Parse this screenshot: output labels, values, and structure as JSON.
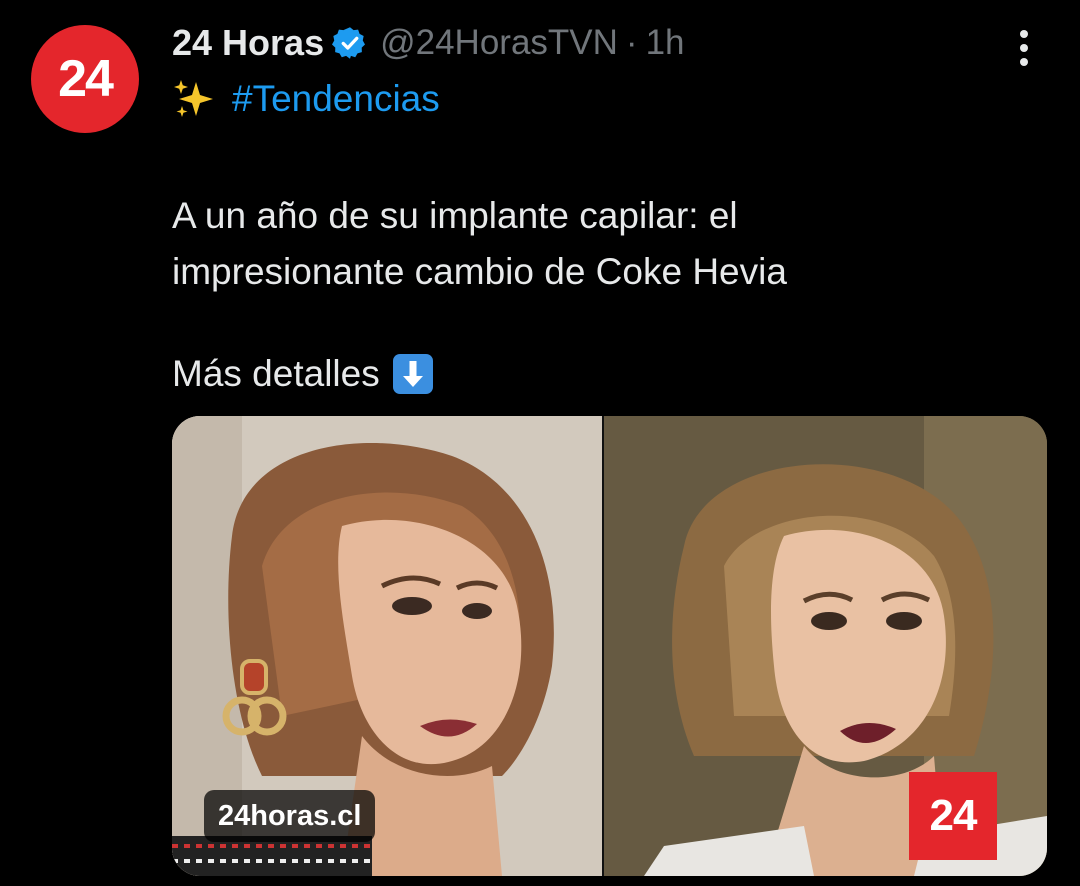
{
  "author": {
    "avatar_text": "24",
    "display_name": "24 Horas",
    "handle": "@24HorasTVN",
    "separator": "·",
    "time": "1h",
    "verified": true
  },
  "post": {
    "emoji": "sparkles",
    "hashtag": "#Tendencias",
    "body_lines": [
      "A un año de su implante capilar: el",
      "impresionante cambio de Coke Hevia"
    ],
    "more_text": "Más detalles",
    "more_emoji": "down-arrow"
  },
  "media": {
    "domain_label": "24horas.cl",
    "logo_text": "24"
  },
  "colors": {
    "background": "#000000",
    "text": "#e7e9ea",
    "muted": "#71767b",
    "link": "#1d9bf0",
    "brand_red": "#e4262c"
  }
}
